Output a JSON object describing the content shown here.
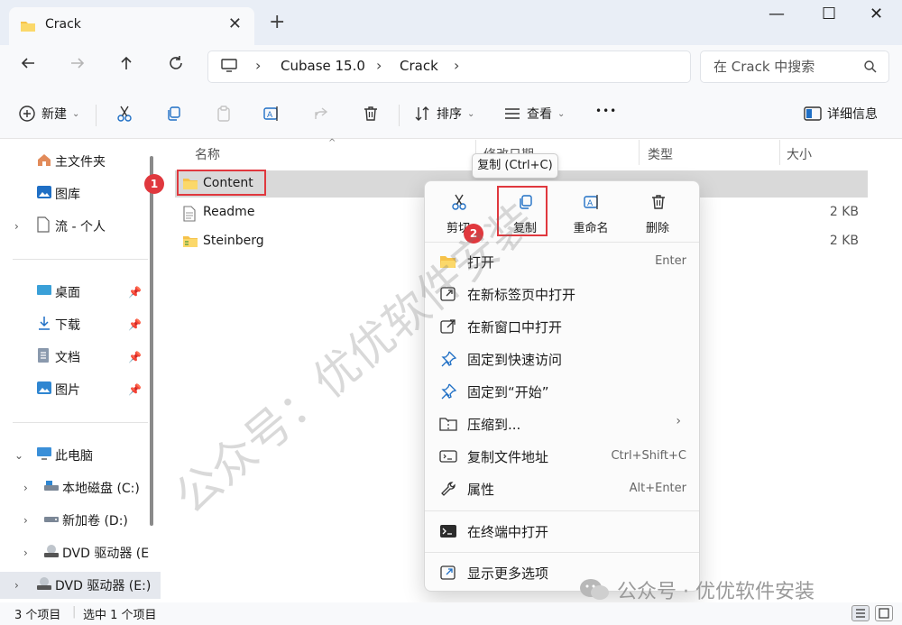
{
  "window": {
    "tab_title": "Crack",
    "tab_close": "✕",
    "new_tab": "+",
    "minimize": "—",
    "maximize": "☐",
    "close": "✕"
  },
  "address": {
    "crumbs": [
      "Cubase 15.0",
      "Crack"
    ],
    "search_placeholder": "在 Crack 中搜索"
  },
  "toolbar": {
    "new_label": "新建",
    "sort_label": "排序",
    "view_label": "查看",
    "more_label": "•••",
    "details_label": "详细信息"
  },
  "sidebar": {
    "items": [
      {
        "label": "主文件夹",
        "icon": "home-icon"
      },
      {
        "label": "图库",
        "icon": "gallery-icon"
      },
      {
        "label": "流 - 个人",
        "icon": "onedrive-icon"
      },
      {
        "label": "桌面",
        "icon": "desktop-icon"
      },
      {
        "label": "下载",
        "icon": "download-icon"
      },
      {
        "label": "文档",
        "icon": "document-icon"
      },
      {
        "label": "图片",
        "icon": "pictures-icon"
      },
      {
        "label": "此电脑",
        "icon": "pc-icon"
      },
      {
        "label": "本地磁盘 (C:)",
        "icon": "drive-icon"
      },
      {
        "label": "新加卷 (D:)",
        "icon": "drive-icon"
      },
      {
        "label": "DVD 驱动器 (E",
        "icon": "dvd-icon"
      },
      {
        "label": "DVD 驱动器 (E:)",
        "icon": "dvd-icon"
      }
    ]
  },
  "filelist": {
    "columns": [
      "名称",
      "修改日期",
      "类型",
      "大小"
    ],
    "rows": [
      {
        "name": "Content",
        "size": ""
      },
      {
        "name": "Readme",
        "size": "2 KB"
      },
      {
        "name": "Steinberg",
        "size": "2 KB"
      }
    ]
  },
  "tooltip": "复制 (Ctrl+C)",
  "context_menu": {
    "quick_actions": [
      "剪切",
      "复制",
      "重命名",
      "删除"
    ],
    "items": [
      {
        "label": "打开",
        "key": "Enter"
      },
      {
        "label": "在新标签页中打开",
        "key": ""
      },
      {
        "label": "在新窗口中打开",
        "key": ""
      },
      {
        "label": "固定到快速访问",
        "key": ""
      },
      {
        "label": "固定到“开始”",
        "key": ""
      },
      {
        "label": "压缩到...",
        "key": ""
      },
      {
        "label": "复制文件地址",
        "key": "Ctrl+Shift+C"
      },
      {
        "label": "属性",
        "key": "Alt+Enter"
      },
      {
        "label": "在终端中打开",
        "key": ""
      },
      {
        "label": "显示更多选项",
        "key": ""
      }
    ],
    "submenu_arrow": "›"
  },
  "annotations": {
    "step1": "1",
    "step2": "2"
  },
  "status": {
    "count": "3 个项目",
    "selected": "选中 1 个项目"
  },
  "watermark": {
    "diagonal": "公众号：优优软件安装",
    "brand": "公众号 · 优优软件安装"
  },
  "colors": {
    "highlight_red": "#e0383e",
    "folder_yellow": "#f6c24a",
    "accent_blue": "#1f6fc5"
  }
}
